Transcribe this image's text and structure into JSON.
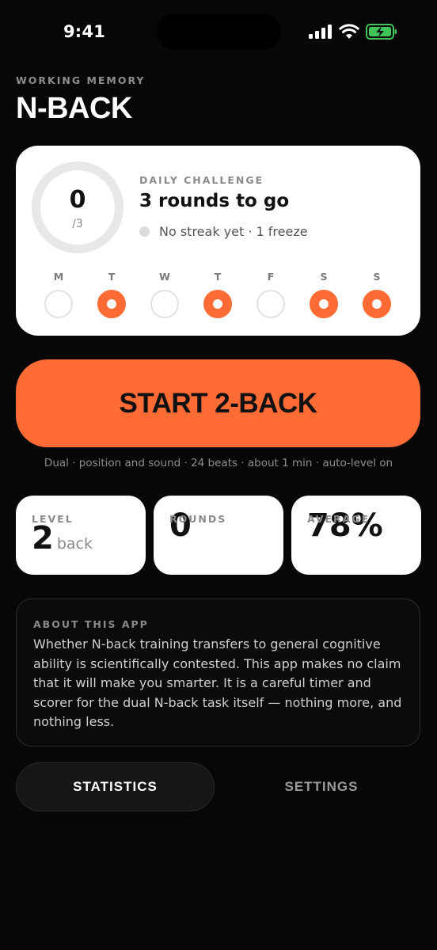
{
  "status_bar": {
    "time": "9:41",
    "battery_color": "#3ec25a"
  },
  "header": {
    "eyebrow": "WORKING MEMORY",
    "title": "N-BACK"
  },
  "daily_challenge": {
    "completed": "0",
    "total": "/3",
    "label": "DAILY CHALLENGE",
    "title": "3 rounds to go",
    "streak": "No streak yet · 1 freeze",
    "days": [
      {
        "letter": "M",
        "done": false
      },
      {
        "letter": "T",
        "done": true
      },
      {
        "letter": "W",
        "done": false
      },
      {
        "letter": "T",
        "done": true
      },
      {
        "letter": "F",
        "done": false
      },
      {
        "letter": "S",
        "done": true
      },
      {
        "letter": "S",
        "done": true
      }
    ]
  },
  "start": {
    "label": "START 2-BACK",
    "subtitle": "Dual · position and sound · 24 beats · about 1 min · auto-level on"
  },
  "stats": {
    "level": {
      "label": "LEVEL",
      "value": "2",
      "suffix": "back"
    },
    "rounds": {
      "label": "ROUNDS",
      "value": "0"
    },
    "average": {
      "label": "AVERAGE",
      "value": "78%"
    }
  },
  "about": {
    "label": "ABOUT THIS APP",
    "text": "Whether N-back training transfers to general cognitive ability is scientifically contested. This app makes no claim that it will make you smarter. It is a careful timer and scorer for the dual N-back task itself — nothing more, and nothing less."
  },
  "tabs": {
    "statistics": "STATISTICS",
    "settings": "SETTINGS"
  },
  "colors": {
    "accent": "#ff6b35",
    "background": "#070707",
    "card": "#ffffff"
  }
}
